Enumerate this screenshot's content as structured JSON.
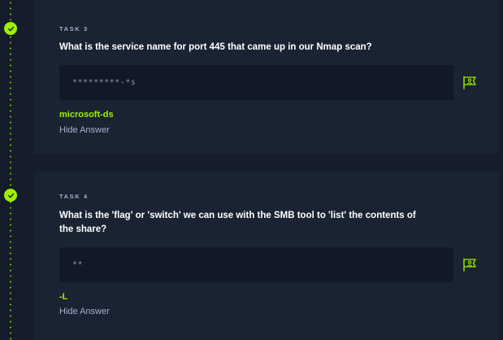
{
  "tasks": [
    {
      "label": "TASK 3",
      "question": "What is the service name for port 445 that came up in our Nmap scan?",
      "answer_mask": "*********-*s",
      "answer": "microsoft-ds",
      "hide_label": "Hide Answer",
      "completed": true
    },
    {
      "label": "TASK 4",
      "question": "What is the 'flag' or 'switch' we can use with the SMB tool to 'list' the contents of the share?",
      "answer_mask": "**",
      "answer": "-L",
      "hide_label": "Hide Answer",
      "completed": true
    }
  ],
  "colors": {
    "accent": "#9fef00",
    "background": "#151c2b",
    "card": "#1a2332",
    "input": "#111927",
    "muted": "#a4b1cd"
  },
  "icons": {
    "completed": "check-icon",
    "hint": "hint-flag-icon"
  }
}
